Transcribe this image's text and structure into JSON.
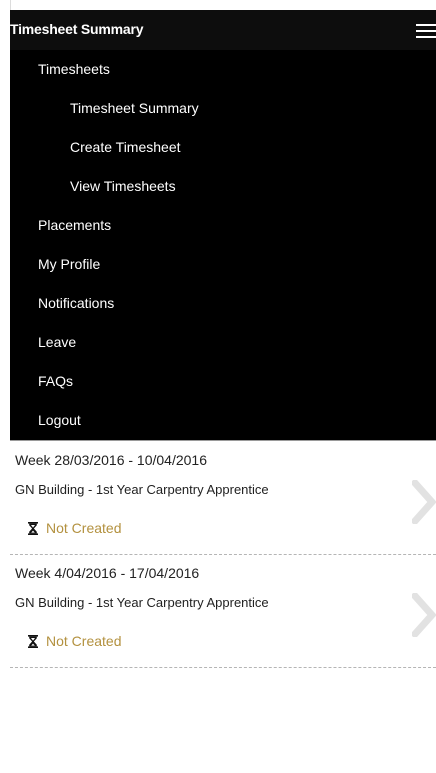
{
  "header": {
    "title": "Timesheet Summary",
    "menu_icon": "hamburger-icon"
  },
  "menu": {
    "items": [
      {
        "label": "Timesheets"
      },
      {
        "label": "Timesheet Summary"
      },
      {
        "label": "Create Timesheet"
      },
      {
        "label": "View Timesheets"
      },
      {
        "label": "Placements"
      },
      {
        "label": "My Profile"
      },
      {
        "label": "Notifications"
      },
      {
        "label": "Leave"
      },
      {
        "label": "FAQs"
      },
      {
        "label": "Logout"
      }
    ]
  },
  "timesheets": [
    {
      "week": "Week 28/03/2016 - 10/04/2016",
      "placement": "GN Building - 1st Year Carpentry Apprentice",
      "status": "Not Created",
      "status_icon": "hourglass-icon"
    },
    {
      "week": "Week 4/04/2016 - 17/04/2016",
      "placement": "GN Building - 1st Year Carpentry Apprentice",
      "status": "Not Created",
      "status_icon": "hourglass-icon"
    }
  ],
  "colors": {
    "header_bg": "#0d0d0d",
    "menu_bg": "#000000",
    "status_text": "#b3913f",
    "chevron": "#e2e2e2"
  }
}
